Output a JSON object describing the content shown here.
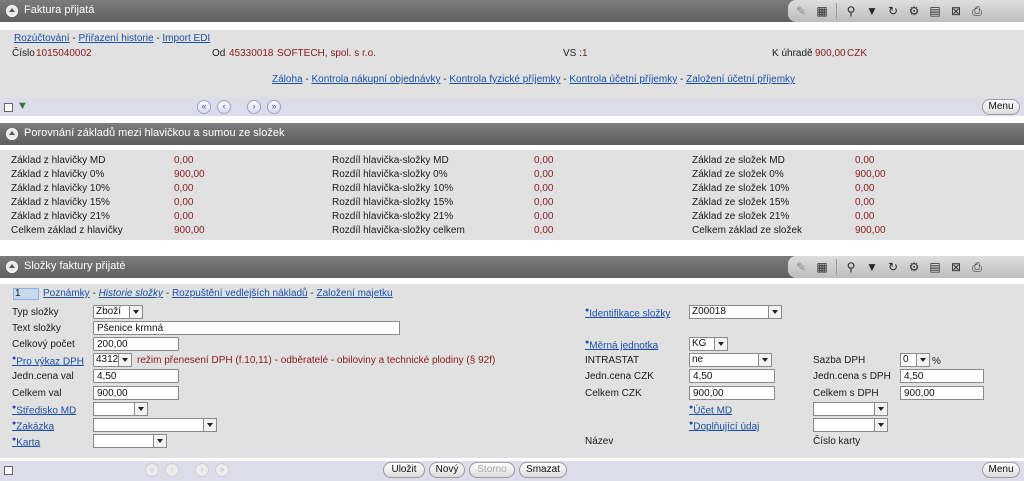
{
  "section1": {
    "title": "Faktura přijatá",
    "links": [
      "Rozúčtování",
      "Přiřazení historie",
      "Import EDI"
    ],
    "cislo_label": "Číslo",
    "cislo_value": "1015040002",
    "od_label": "Od",
    "od_value": "45330018",
    "od_name": "SOFTECH, spol. s r.o.",
    "vs_label": "VS :",
    "vs_value": "1",
    "k_uhrade_label": "K úhradě",
    "k_uhrade_value": "900,00",
    "currency": "CZK",
    "sublinks": [
      "Záloha",
      "Kontrola nákupní objednávky",
      "Kontrola fyzické příjemky",
      "Kontrola účetní příjemky",
      "Založení účetní příjemky"
    ],
    "menu_label": "Menu"
  },
  "section2": {
    "title": "Porovnání základů mezi hlavičkou a sumou ze složek",
    "col1": [
      {
        "label": "Základ z hlavičky MD",
        "value": "0,00"
      },
      {
        "label": "Základ z hlavičky 0%",
        "value": "900,00"
      },
      {
        "label": "Základ z hlavičky 10%",
        "value": "0,00"
      },
      {
        "label": "Základ z hlavičky 15%",
        "value": "0,00"
      },
      {
        "label": "Základ z hlavičky 21%",
        "value": "0,00"
      },
      {
        "label": "Celkem základ z hlavičky",
        "value": "900,00"
      }
    ],
    "col2": [
      {
        "label": "Rozdíl hlavička-složky MD",
        "value": "0,00"
      },
      {
        "label": "Rozdíl hlavička-složky 0%",
        "value": "0,00"
      },
      {
        "label": "Rozdíl hlavička-složky 10%",
        "value": "0,00"
      },
      {
        "label": "Rozdíl hlavička-složky 15%",
        "value": "0,00"
      },
      {
        "label": "Rozdíl hlavička-složky 21%",
        "value": "0,00"
      },
      {
        "label": "Rozdíl hlavička-složky celkem",
        "value": "0,00"
      }
    ],
    "col3": [
      {
        "label": "Základ ze složek MD",
        "value": "0,00"
      },
      {
        "label": "Základ ze složek 0%",
        "value": "900,00"
      },
      {
        "label": "Základ ze složek 10%",
        "value": "0,00"
      },
      {
        "label": "Základ ze složek 15%",
        "value": "0,00"
      },
      {
        "label": "Základ ze složek 21%",
        "value": "0,00"
      },
      {
        "label": "Celkem základ ze složek",
        "value": "900,00"
      }
    ]
  },
  "section3": {
    "title": "Složky faktury přijaté",
    "record_number": "1",
    "links": [
      "Poznámky",
      "Historie složky",
      "Rozpuštění vedlejších nákladů",
      "Založení majetku"
    ],
    "typ_slozky_label": "Typ složky",
    "typ_slozky_value": "Zboží",
    "text_slozky_label": "Text složky",
    "text_slozky_value": "Pšenice krmná",
    "celkovy_pocet_label": "Celkový počet",
    "celkovy_pocet_value": "200,00",
    "pro_vykaz_dph_label": "Pro výkaz DPH",
    "pro_vykaz_dph_value": "4312",
    "pro_vykaz_dph_desc": "režim přenesení DPH (f.10,11) - odběratelé - obiloviny a technické plodiny (§ 92f)",
    "jedn_cena_val_label": "Jedn.cena val",
    "jedn_cena_val_value": "4,50",
    "celkem_val_label": "Celkem val",
    "celkem_val_value": "900,00",
    "stredisko_md_label": "Středisko MD",
    "zakazka_label": "Zakázka",
    "karta_label": "Karta",
    "identifikace_slozky_label": "Identifikace složky",
    "identifikace_slozky_value": "Z00018",
    "merna_jednotka_label": "Měrná jednotka",
    "merna_jednotka_value": "KG",
    "intrastat_label": "INTRASTAT",
    "intrastat_value": "ne",
    "jedn_cena_czk_label": "Jedn.cena CZK",
    "jedn_cena_czk_value": "4,50",
    "celkem_czk_label": "Celkem CZK",
    "celkem_czk_value": "900,00",
    "ucet_md_label": "Účet MD",
    "doplnujici_udaj_label": "Doplňující údaj",
    "nazev_label": "Název",
    "sazba_dph_label": "Sazba DPH",
    "sazba_dph_value": "0",
    "percent": "%",
    "jedn_cena_s_dph_label": "Jedn.cena s DPH",
    "jedn_cena_s_dph_value": "4,50",
    "celkem_s_dph_label": "Celkem s DPH",
    "celkem_s_dph_value": "900,00",
    "cislo_karty_label": "Číslo karty"
  },
  "footer": {
    "ulozit": "Uložit",
    "novy": "Nový",
    "storno": "Storno",
    "smazat": "Smazat",
    "menu_label": "Menu"
  },
  "nav": {
    "first": "«",
    "prev": "‹",
    "next": "›",
    "last": "»"
  }
}
